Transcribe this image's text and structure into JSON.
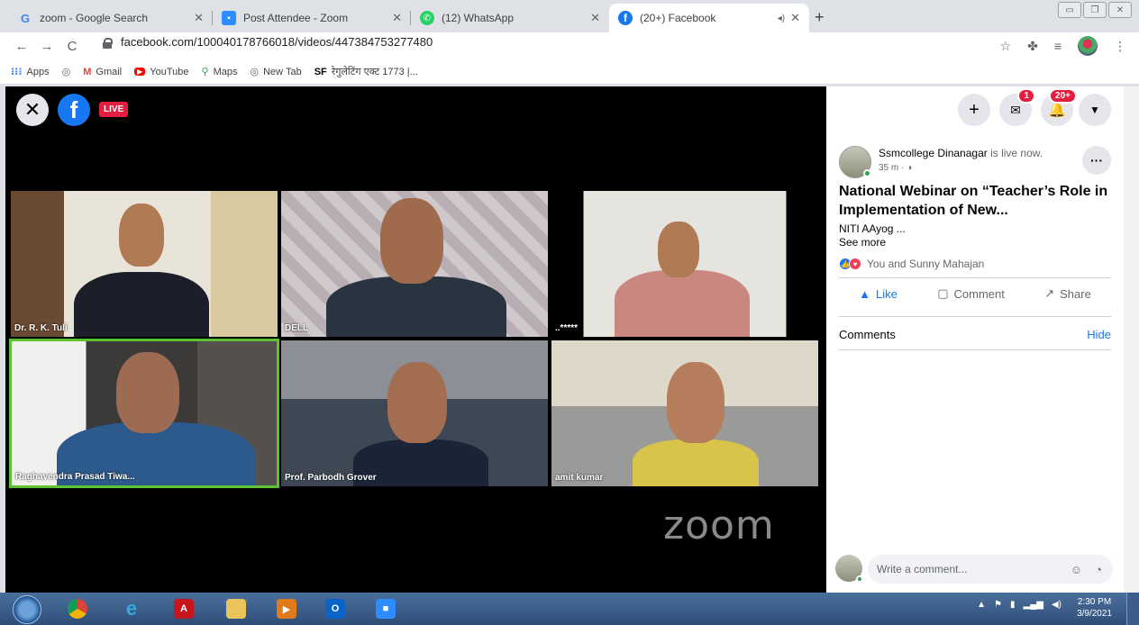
{
  "browser": {
    "tabs": [
      {
        "title": "zoom - Google Search",
        "icon": "google-icon",
        "active": false
      },
      {
        "title": "Post Attendee - Zoom",
        "icon": "zoom-icon",
        "active": false
      },
      {
        "title": "(12) WhatsApp",
        "icon": "whatsapp-icon",
        "active": false
      },
      {
        "title": "(20+) Facebook",
        "icon": "facebook-icon",
        "active": true
      }
    ],
    "url": "facebook.com/100040178766018/videos/447384753277480",
    "bookmarks": [
      {
        "label": "Apps",
        "icon": "apps-grid-icon"
      },
      {
        "label": "",
        "icon": "globe-icon"
      },
      {
        "label": "Gmail",
        "icon": "gmail-icon"
      },
      {
        "label": "YouTube",
        "icon": "youtube-icon"
      },
      {
        "label": "Maps",
        "icon": "maps-icon"
      },
      {
        "label": "New Tab",
        "icon": "globe-icon"
      },
      {
        "label": "रेगुलेटिंग एक्ट 1773 |...",
        "icon": "sf-icon"
      }
    ],
    "bookmark_sf_prefix": "SF"
  },
  "video": {
    "live_label": "LIVE",
    "watermark": "zoom",
    "participants": [
      {
        "name": "Dr. R. K. Tuli"
      },
      {
        "name": "DELL"
      },
      {
        "name": "..*****"
      },
      {
        "name": "Raghavendra Prasad Tiwa..."
      },
      {
        "name": "Prof. Parbodh Grover"
      },
      {
        "name": "amit kumar"
      }
    ],
    "active_speaker_color": "#5bc236"
  },
  "facebook": {
    "header": {
      "messenger_badge": "1",
      "notifications_badge": "20+"
    },
    "post": {
      "page_name": "Ssmcollege Dinanagar",
      "status": " is live now.",
      "time": "35 m · ",
      "title": "National Webinar on “Teacher’s Role in Implementation of New...",
      "desc": "NITI AAyog ...",
      "see_more": "See more",
      "reactions_text": "You and Sunny Mahajan",
      "actions": {
        "like": "Like",
        "comment": "Comment",
        "share": "Share"
      }
    },
    "comments_heading": "Comments",
    "hide_label": "Hide",
    "comment_placeholder": "Write a comment...",
    "brand_color": "#1877f2"
  },
  "taskbar": {
    "time": "2:30 PM",
    "date": "3/9/2021"
  }
}
